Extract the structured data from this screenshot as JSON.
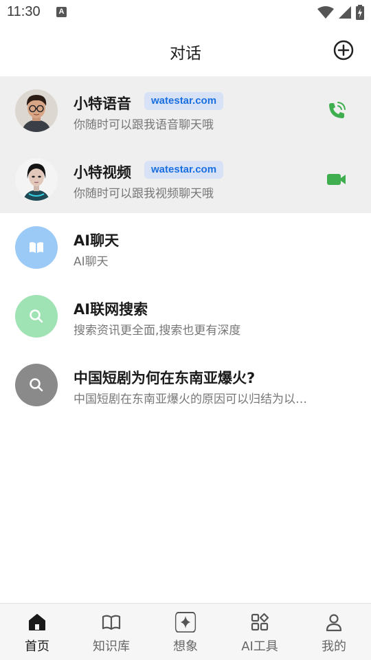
{
  "status_bar": {
    "time": "11:30",
    "notification_glyph": "A"
  },
  "header": {
    "title": "对话",
    "add_icon": "plus-circle-icon"
  },
  "pinned": [
    {
      "title": "小特语音",
      "badge": "watestar.com",
      "subtitle": "你随时可以跟我语音聊天哦",
      "avatar": "boy-avatar",
      "action_icon": "phone-icon",
      "accent": "#3fae4f"
    },
    {
      "title": "小特视频",
      "badge": "watestar.com",
      "subtitle": "你随时可以跟我视频聊天哦",
      "avatar": "girl-avatar",
      "action_icon": "video-camera-icon",
      "accent": "#3fae4f"
    }
  ],
  "chats": [
    {
      "title": "AI聊天",
      "subtitle": "AI聊天",
      "icon": "book-icon",
      "color": "#9ccaf6"
    },
    {
      "title": "AI联网搜索",
      "subtitle": "搜索资讯更全面,搜索也更有深度",
      "icon": "search-icon",
      "color": "#9fe2b4"
    },
    {
      "title": "中国短剧为何在东南亚爆火?",
      "subtitle": "中国短剧在东南亚爆火的原因可以归结为以…",
      "icon": "search-icon",
      "color": "#8a8a8a"
    }
  ],
  "tabs": [
    {
      "label": "首页",
      "icon": "home-icon",
      "active": true
    },
    {
      "label": "知识库",
      "icon": "book-icon",
      "active": false
    },
    {
      "label": "想象",
      "icon": "sparkle-icon",
      "active": false
    },
    {
      "label": "AI工具",
      "icon": "grid-icon",
      "active": false
    },
    {
      "label": "我的",
      "icon": "person-icon",
      "active": false
    }
  ]
}
